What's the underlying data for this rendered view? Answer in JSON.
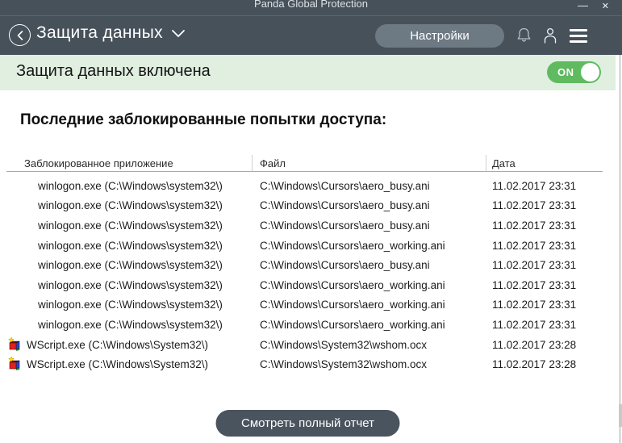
{
  "window": {
    "title": "Panda Global Protection",
    "minimize_glyph": "—",
    "close_glyph": "✕"
  },
  "appbar": {
    "title": "Защита данных",
    "settings_label": "Настройки"
  },
  "banner": {
    "status_text": "Защита данных включена",
    "toggle_state": "ON"
  },
  "main": {
    "section_title": "Последние заблокированные попытки доступа:",
    "table": {
      "headers": [
        "Заблокированное приложение",
        "Файл",
        "Дата"
      ],
      "rows": [
        {
          "app": "winlogon.exe (C:\\Windows\\system32\\)",
          "file": "C:\\Windows\\Cursors\\aero_busy.ani",
          "date": "11.02.2017 23:31",
          "icon": null
        },
        {
          "app": "winlogon.exe (C:\\Windows\\system32\\)",
          "file": "C:\\Windows\\Cursors\\aero_busy.ani",
          "date": "11.02.2017 23:31",
          "icon": null
        },
        {
          "app": "winlogon.exe (C:\\Windows\\system32\\)",
          "file": "C:\\Windows\\Cursors\\aero_busy.ani",
          "date": "11.02.2017 23:31",
          "icon": null
        },
        {
          "app": "winlogon.exe (C:\\Windows\\system32\\)",
          "file": "C:\\Windows\\Cursors\\aero_working.ani",
          "date": "11.02.2017 23:31",
          "icon": null
        },
        {
          "app": "winlogon.exe (C:\\Windows\\system32\\)",
          "file": "C:\\Windows\\Cursors\\aero_busy.ani",
          "date": "11.02.2017 23:31",
          "icon": null
        },
        {
          "app": "winlogon.exe (C:\\Windows\\system32\\)",
          "file": "C:\\Windows\\Cursors\\aero_working.ani",
          "date": "11.02.2017 23:31",
          "icon": null
        },
        {
          "app": "winlogon.exe (C:\\Windows\\system32\\)",
          "file": "C:\\Windows\\Cursors\\aero_working.ani",
          "date": "11.02.2017 23:31",
          "icon": null
        },
        {
          "app": "winlogon.exe (C:\\Windows\\system32\\)",
          "file": "C:\\Windows\\Cursors\\aero_working.ani",
          "date": "11.02.2017 23:31",
          "icon": null
        },
        {
          "app": "WScript.exe (C:\\Windows\\System32\\)",
          "file": "C:\\Windows\\System32\\wshom.ocx",
          "date": "11.02.2017 23:28",
          "icon": "wscript-icon"
        },
        {
          "app": "WScript.exe (C:\\Windows\\System32\\)",
          "file": "C:\\Windows\\System32\\wshom.ocx",
          "date": "11.02.2017 23:28",
          "icon": "wscript-icon"
        }
      ]
    },
    "report_button_label": "Смотреть полный отчет"
  },
  "icons": {
    "back": "chevron-left-circle",
    "title_caret": "chevron-down",
    "notifications": "bell",
    "account": "user",
    "menu": "hamburger",
    "row_app": "wscript-cube"
  },
  "colors": {
    "header_bg": "#47515a",
    "settings_pill": "#6d7983",
    "banner_bg": "#e1efe0",
    "toggle_green": "#5fba60",
    "report_button_bg": "#4a545e"
  }
}
